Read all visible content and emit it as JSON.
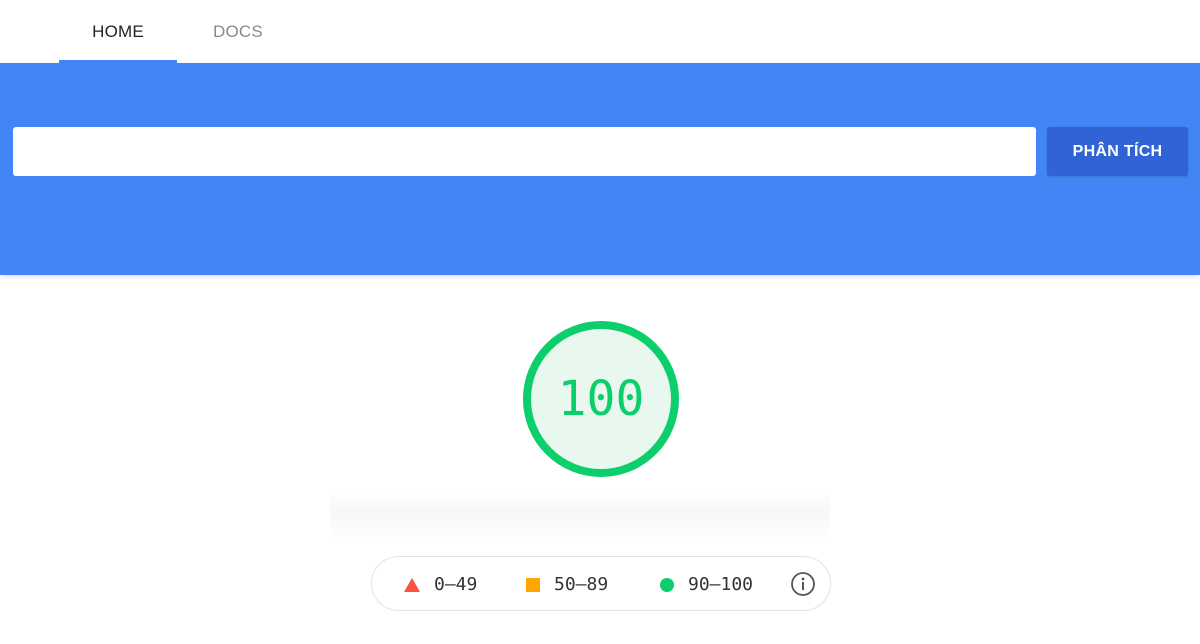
{
  "nav": {
    "tabs": [
      {
        "label": "HOME",
        "active": true
      },
      {
        "label": "DOCS",
        "active": false
      }
    ]
  },
  "search": {
    "value": "",
    "placeholder": "",
    "button_label": "PHÂN TÍCH"
  },
  "score": {
    "value": "100",
    "color": "#0cce6b"
  },
  "legend": {
    "items": [
      {
        "label": "0–49",
        "icon": "triangle-icon",
        "color": "#ff4e42"
      },
      {
        "label": "50–89",
        "icon": "square-icon",
        "color": "#ffa400"
      },
      {
        "label": "90–100",
        "icon": "circle-icon",
        "color": "#0cce6b"
      }
    ],
    "info_icon": "info-icon"
  },
  "colors": {
    "banner": "#4285f4",
    "button": "#2f63d6",
    "tab_indicator": "#4285f4"
  }
}
